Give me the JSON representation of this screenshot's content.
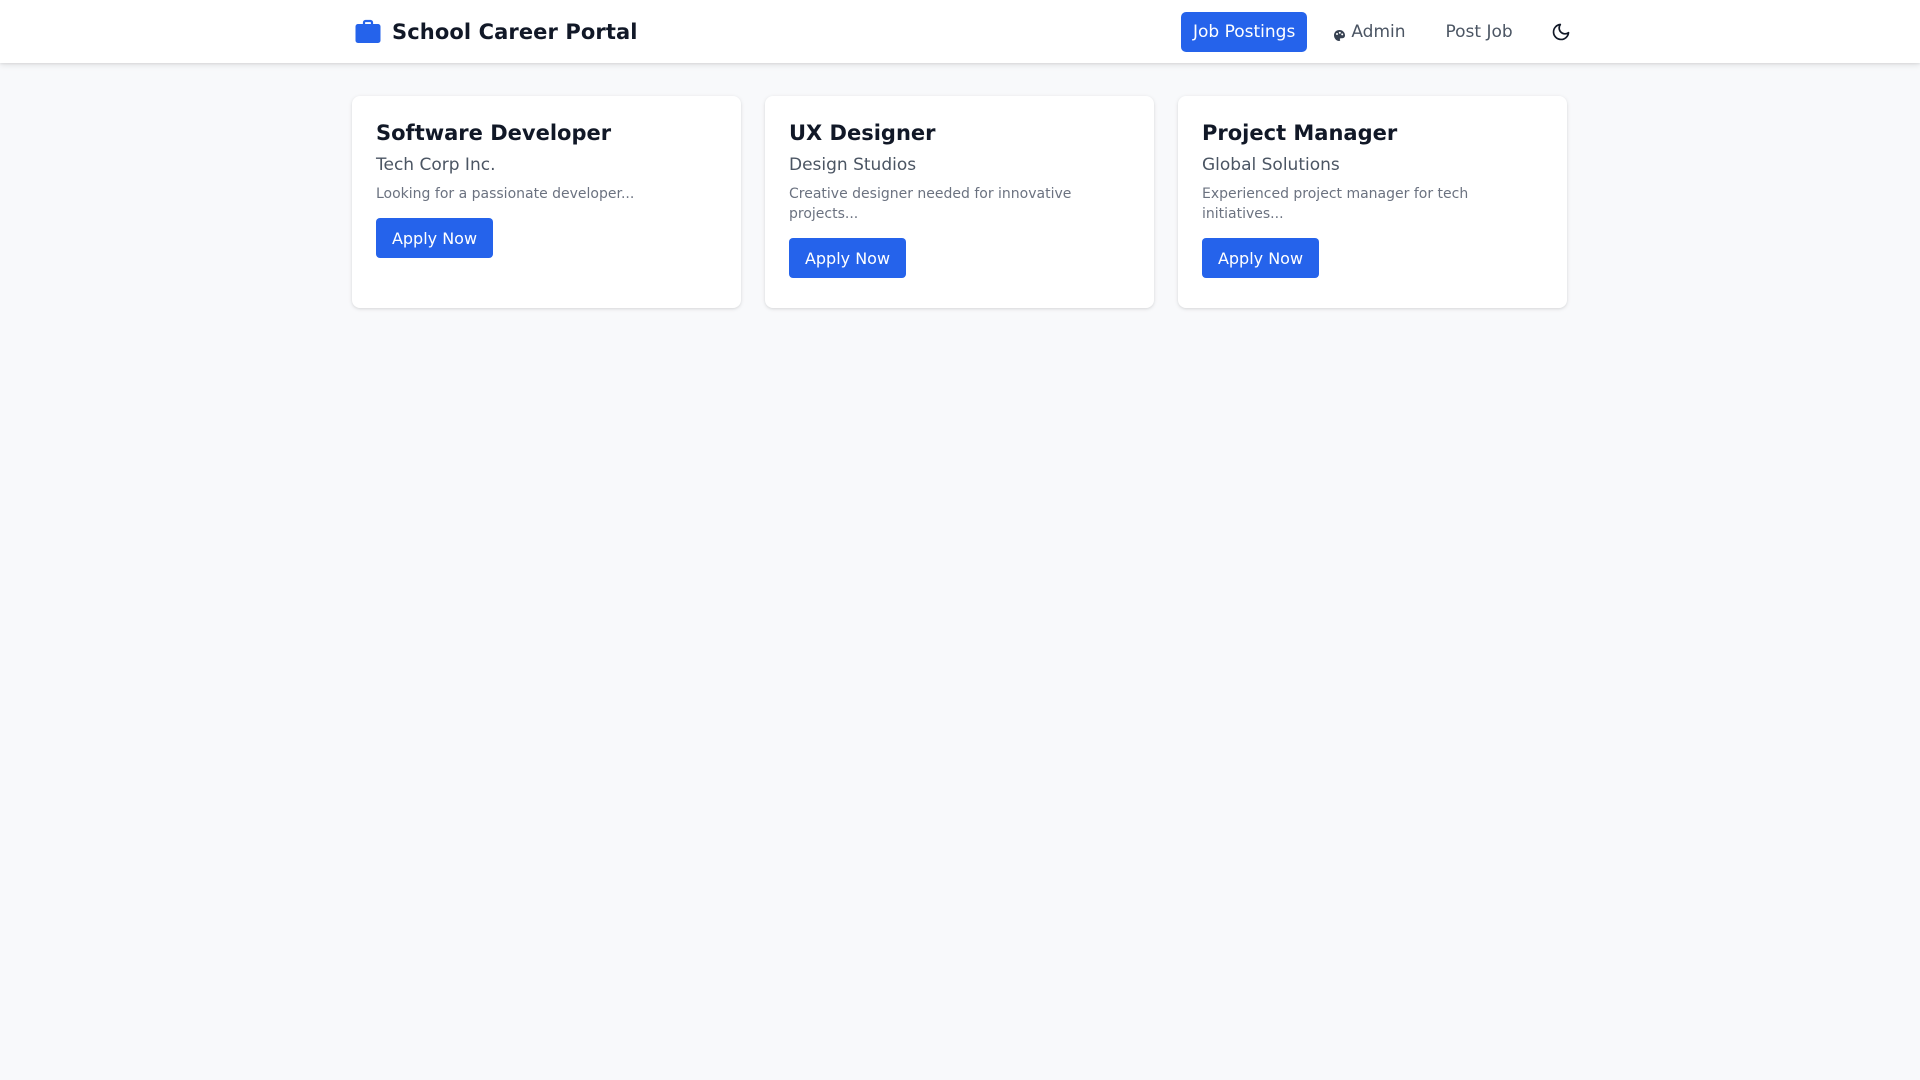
{
  "app": {
    "title": "School Career Portal",
    "brand_icon": "briefcase-icon",
    "accent_color": "#2563eb"
  },
  "nav": {
    "job_postings": "Job Postings",
    "admin": "Admin",
    "admin_icon": "palette-icon",
    "post_job": "Post Job",
    "theme_toggle_icon": "moon-icon"
  },
  "jobs": [
    {
      "title": "Software Developer",
      "company": "Tech Corp Inc.",
      "description": "Looking for a passionate developer...",
      "apply_label": "Apply Now"
    },
    {
      "title": "UX Designer",
      "company": "Design Studios",
      "description": "Creative designer needed for innovative projects...",
      "apply_label": "Apply Now"
    },
    {
      "title": "Project Manager",
      "company": "Global Solutions",
      "description": "Experienced project manager for tech initiatives...",
      "apply_label": "Apply Now"
    }
  ]
}
